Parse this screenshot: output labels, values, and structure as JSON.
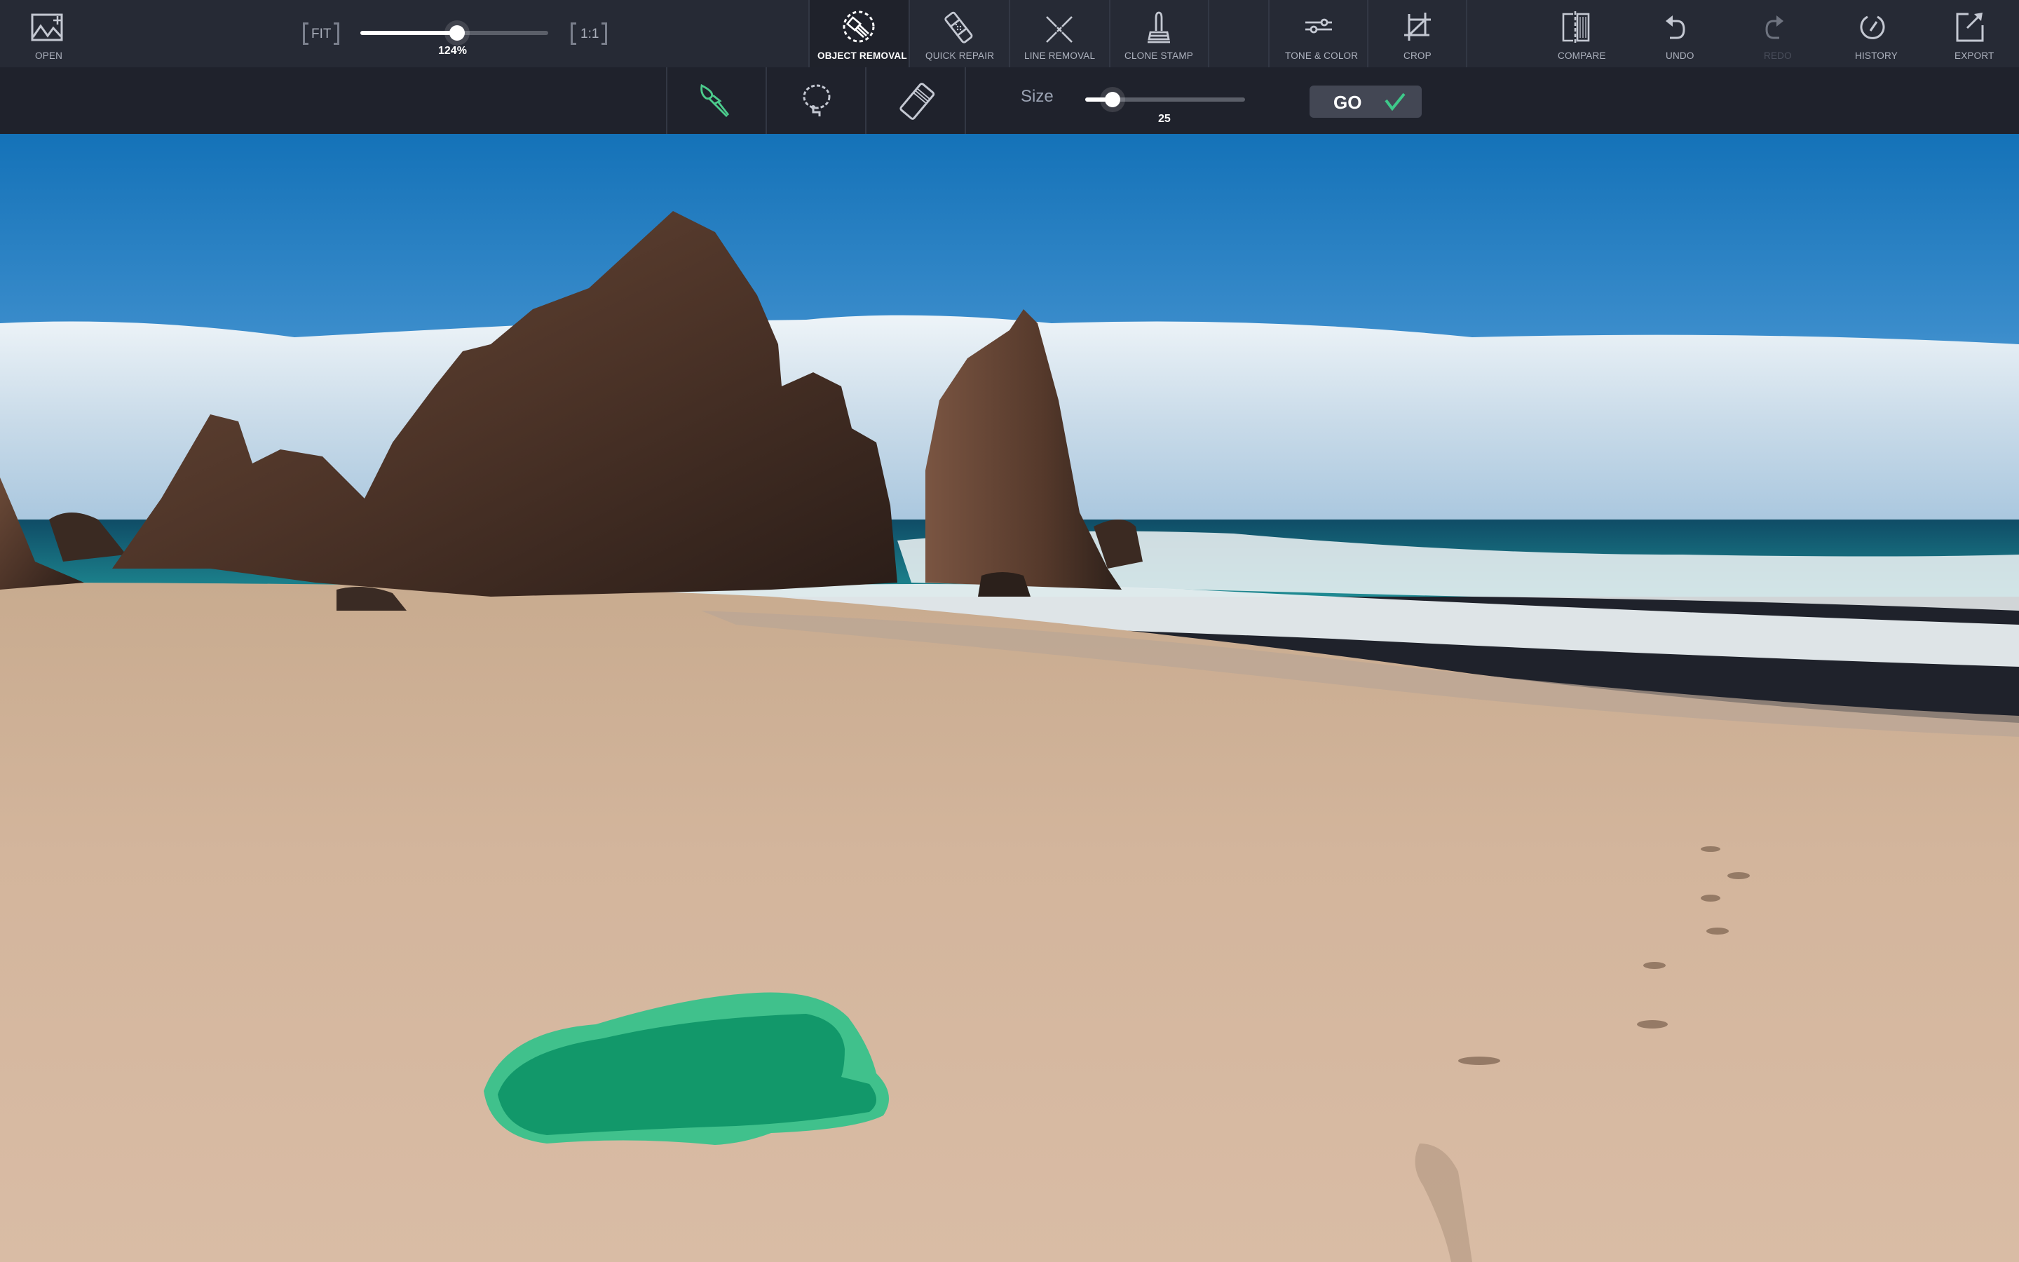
{
  "toolbar": {
    "open": {
      "label": "OPEN",
      "icon": "open-image-icon"
    },
    "zoom": {
      "fit_label": "FIT",
      "one_to_one_label": "1:1",
      "value_label": "124%",
      "slider_fraction": 0.515
    },
    "tools": [
      {
        "label": "OBJECT REMOVAL",
        "icon": "object-removal-icon",
        "active": true
      },
      {
        "label": "QUICK REPAIR",
        "icon": "bandage-icon",
        "active": false
      },
      {
        "label": "LINE REMOVAL",
        "icon": "line-removal-icon",
        "active": false
      },
      {
        "label": "CLONE STAMP",
        "icon": "stamp-icon",
        "active": false
      },
      {
        "label": "TONE & COLOR",
        "icon": "sliders-icon",
        "active": false
      },
      {
        "label": "CROP",
        "icon": "crop-icon",
        "active": false
      }
    ],
    "right": [
      {
        "label": "COMPARE",
        "icon": "compare-icon",
        "enabled": true
      },
      {
        "label": "UNDO",
        "icon": "undo-icon",
        "enabled": true
      },
      {
        "label": "REDO",
        "icon": "redo-icon",
        "enabled": false
      },
      {
        "label": "HISTORY",
        "icon": "history-icon",
        "enabled": true
      },
      {
        "label": "EXPORT",
        "icon": "export-icon",
        "enabled": true
      }
    ]
  },
  "subtoolbar": {
    "selection_tools": [
      {
        "name": "brush",
        "icon": "brush-icon",
        "active": true
      },
      {
        "name": "lasso",
        "icon": "lasso-icon",
        "active": false
      },
      {
        "name": "eraser",
        "icon": "eraser-icon",
        "active": false
      }
    ],
    "size": {
      "label": "Size",
      "value": "25",
      "slider_fraction": 0.17
    },
    "go_label": "GO"
  },
  "canvas": {
    "image_subject": "beach with sea stacks, ocean waves and footprints in sand",
    "mask_color": "#2fc389",
    "mask_target": "driftwood log on sand (selected for removal)"
  },
  "colors": {
    "toolbar_bg": "#262a35",
    "subtoolbar_bg": "#1f222c",
    "accent_green": "#3ec98a",
    "go_button_bg": "#434754"
  }
}
